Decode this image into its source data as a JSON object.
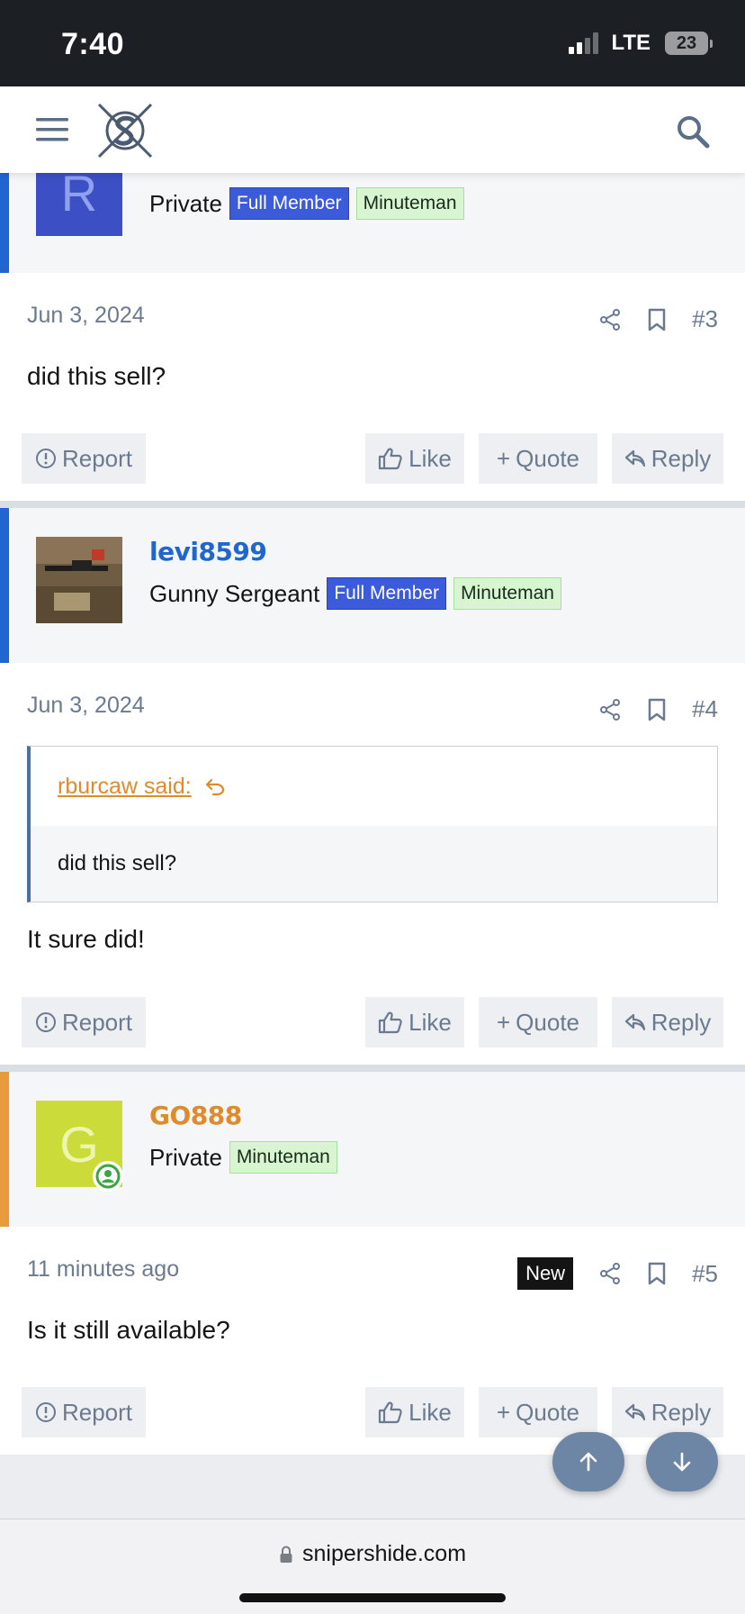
{
  "status_bar": {
    "time": "7:40",
    "network": "LTE",
    "battery": "23"
  },
  "header": {
    "logo_alt": "logo"
  },
  "posts": [
    {
      "avatar_letter": "R",
      "avatar_color": "#3d4fc4",
      "rank": "Private",
      "badges": [
        "Full Member",
        "Minuteman"
      ],
      "date": "Jun 3, 2024",
      "number": "#3",
      "message": "did this sell?"
    },
    {
      "username": "levi8599",
      "rank": "Gunny Sergeant",
      "badges": [
        "Full Member",
        "Minuteman"
      ],
      "date": "Jun 3, 2024",
      "number": "#4",
      "quote_author": "rburcaw said:",
      "quote_text": "did this sell?",
      "message": "It sure did!"
    },
    {
      "username": "GO888",
      "avatar_letter": "G",
      "avatar_color": "#cadb3a",
      "rank": "Private",
      "badges": [
        "Minuteman"
      ],
      "date": "11 minutes ago",
      "new_label": "New",
      "number": "#5",
      "message": "Is it still available?"
    }
  ],
  "actions": {
    "report": "Report",
    "like": "Like",
    "quote": "Quote",
    "reply": "Reply"
  },
  "browser": {
    "url": "snipershide.com"
  },
  "colors": {
    "accent_blue": "#1f66d1",
    "accent_orange": "#e89b3a",
    "badge_blue": "#3b5bdb",
    "badge_green": "#d6f5d0"
  }
}
